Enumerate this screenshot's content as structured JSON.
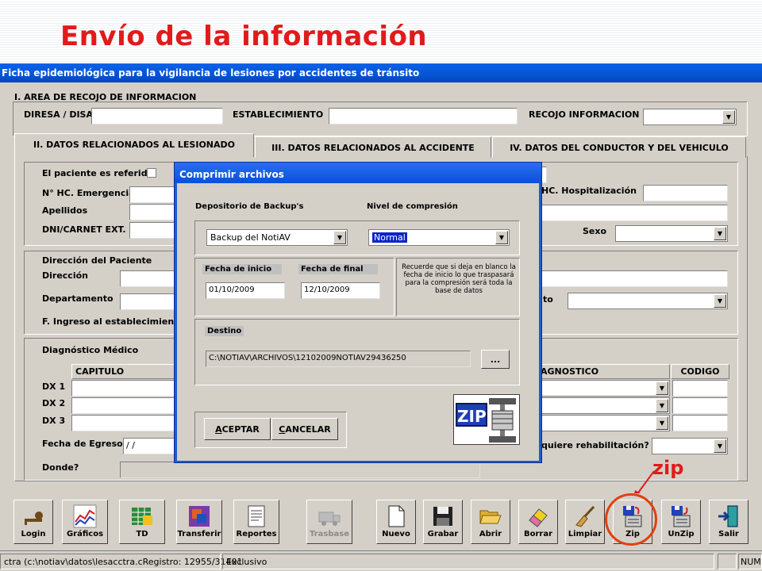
{
  "slide": {
    "title": "Envío de la información",
    "zip_annotation": "zip"
  },
  "window": {
    "title": "Ficha epidemiológica para la vigilancia de lesiones por accidentes de tránsito"
  },
  "section1": {
    "heading": "I. AREA DE RECOJO DE INFORMACION",
    "diresa_label": "DIRESA / DISA",
    "establecimiento_label": "ESTABLECIMIENTO",
    "recojo_label": "RECOJO INFORMACION"
  },
  "tabs": [
    "II. DATOS RELACIONADOS AL LESIONADO",
    "III. DATOS RELACIONADOS AL ACCIDENTE",
    "IV. DATOS DEL CONDUCTOR Y DEL VEHICULO"
  ],
  "patient": {
    "referido_label": "El paciente es referido",
    "hc_emergencia_label": "N° HC. Emergencia",
    "apellidos_label": "Apellidos",
    "dni_label": "DNI/CARNET EXT.",
    "hc_hosp_label": "HC. Hospitalización",
    "sexo_label": "Sexo"
  },
  "address": {
    "section_label": "Dirección del Paciente",
    "direccion_label": "Dirección",
    "departamento_label": "Departamento",
    "distrito_fragment": "to",
    "ingreso_label": "F. Ingreso al establecimiento"
  },
  "diagnosis": {
    "section_label": "Diagnóstico Médico",
    "capitulo_header": "CAPITULO",
    "diagnostico_header": "AGNOSTICO",
    "codigo_header": "CODIGO",
    "rows": [
      "DX 1",
      "DX 2",
      "DX 3"
    ],
    "egreso_label": "Fecha de Egreso",
    "egreso_value": " / /",
    "rehab_label": "quiere rehabilitación?",
    "donde_label": "Donde?"
  },
  "dialog": {
    "title": "Comprimir archivos",
    "depositorio_label": "Depositorio de Backup's",
    "depositorio_value": "Backup del NotiAV",
    "nivel_label": "Nivel de compresión",
    "nivel_value": "Normal",
    "fecha_inicio_label": "Fecha de inicio",
    "fecha_inicio_value": "01/10/2009",
    "fecha_final_label": "Fecha de final",
    "fecha_final_value": "12/10/2009",
    "note": "Recuerde que si deja en blanco la fecha de inicio lo que traspasará para la compresión será toda la base de datos",
    "destino_label": "Destino",
    "destino_value": "C:\\NOTIAV\\ARCHIVOS\\12102009NOTIAV29436250",
    "browse_label": "...",
    "aceptar_first": "A",
    "aceptar_rest": "CEPTAR",
    "cancelar_first": "C",
    "cancelar_rest": "ANCELAR",
    "zip_logo_text": "ZIP"
  },
  "toolbar": [
    {
      "label": "Login",
      "icon": "key-icon"
    },
    {
      "label": "Gráficos",
      "icon": "chart-icon"
    },
    {
      "label": "TD",
      "icon": "spreadsheet-icon"
    },
    {
      "label": "Transferir",
      "icon": "transfer-icon"
    },
    {
      "label": "Reportes",
      "icon": "report-icon"
    },
    {
      "label": "Trasbase",
      "icon": "ambulance-icon"
    },
    {
      "label": "Nuevo",
      "icon": "new-document-icon"
    },
    {
      "label": "Grabar",
      "icon": "floppy-disk-icon"
    },
    {
      "label": "Abrir",
      "icon": "open-folder-icon"
    },
    {
      "label": "Borrar",
      "icon": "eraser-icon"
    },
    {
      "label": "Limpiar",
      "icon": "broom-icon"
    },
    {
      "label": "Zip",
      "icon": "zip-icon"
    },
    {
      "label": "UnZip",
      "icon": "unzip-icon"
    },
    {
      "label": "Salir",
      "icon": "exit-icon"
    }
  ],
  "status": {
    "path": "ctra (c:\\notiav\\datos\\lesacctra.cRegistro: 12955/31401",
    "mode": "Exclusivo",
    "num": "NUM"
  },
  "colors": {
    "title_red": "#e11b1b",
    "titlebar_blue": "#0554d4",
    "face": "#d4d0c8",
    "highlight": "#0a24c8"
  }
}
